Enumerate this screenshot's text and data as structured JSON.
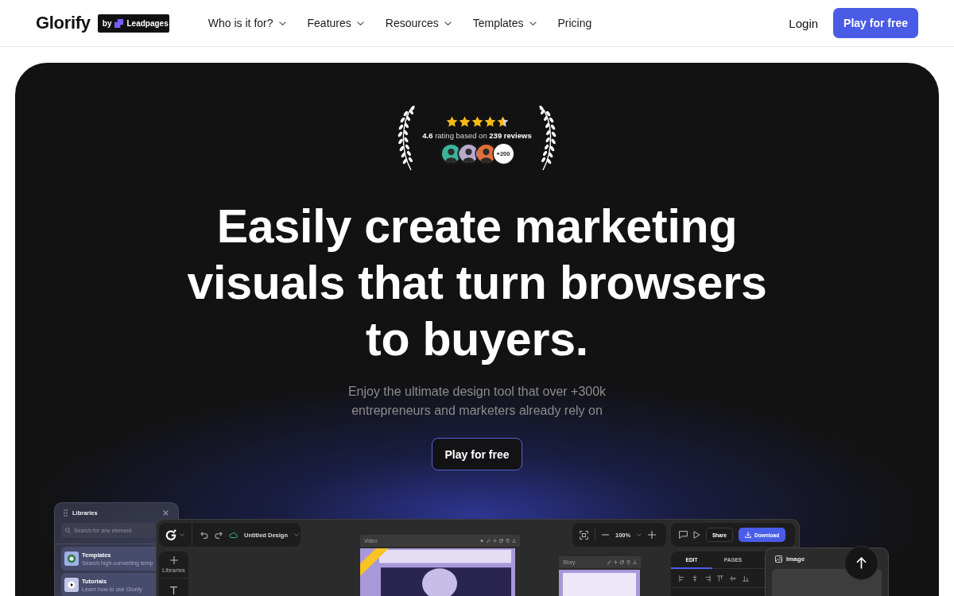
{
  "header": {
    "logo": "Glorify",
    "partner_badge": {
      "prefix": "by",
      "brand": "Leadpages"
    },
    "nav": [
      {
        "label": "Who is it for?",
        "dropdown": true
      },
      {
        "label": "Features",
        "dropdown": true
      },
      {
        "label": "Resources",
        "dropdown": true
      },
      {
        "label": "Templates",
        "dropdown": true
      },
      {
        "label": "Pricing",
        "dropdown": false
      }
    ],
    "login": "Login",
    "cta": "Play for free"
  },
  "hero": {
    "rating": {
      "stars": 4.5,
      "text": "**4.6** rating based on **239 reviews**",
      "avatars": [
        {
          "color": "#3db39b"
        },
        {
          "color": "#b9a9cc"
        },
        {
          "color": "#e0703a"
        }
      ],
      "more": "+200"
    },
    "headline": "Easily create marketing visuals that turn browsers to buyers.",
    "subtitle": "Enjoy the ultimate design tool that over +300k entrepreneurs and marketers already rely on",
    "cta": "Play for free"
  },
  "app_preview": {
    "libraries": {
      "title": "Libraries",
      "search": {
        "placeholder": "Search for any element"
      },
      "items": [
        {
          "kind": "templates",
          "title": "Templates",
          "description": "Search high-converting temp"
        },
        {
          "kind": "tutorials",
          "title": "Tutorials",
          "description": "Learn how to use Glorify"
        }
      ]
    },
    "toolbar": {
      "document_title": "Untitled Design",
      "zoom": "100%",
      "share": "Share",
      "download": "Download"
    },
    "tool_rail": [
      {
        "kind": "add",
        "label": "Libraries"
      },
      {
        "kind": "text"
      }
    ],
    "frames": [
      {
        "kind": "video",
        "label": "Video"
      },
      {
        "kind": "story",
        "label": "Story"
      }
    ],
    "panel_tabs": [
      {
        "label": "EDIT",
        "selected": true
      },
      {
        "label": "PAGES",
        "selected": false
      }
    ],
    "image_panel": {
      "title": "Image"
    }
  }
}
